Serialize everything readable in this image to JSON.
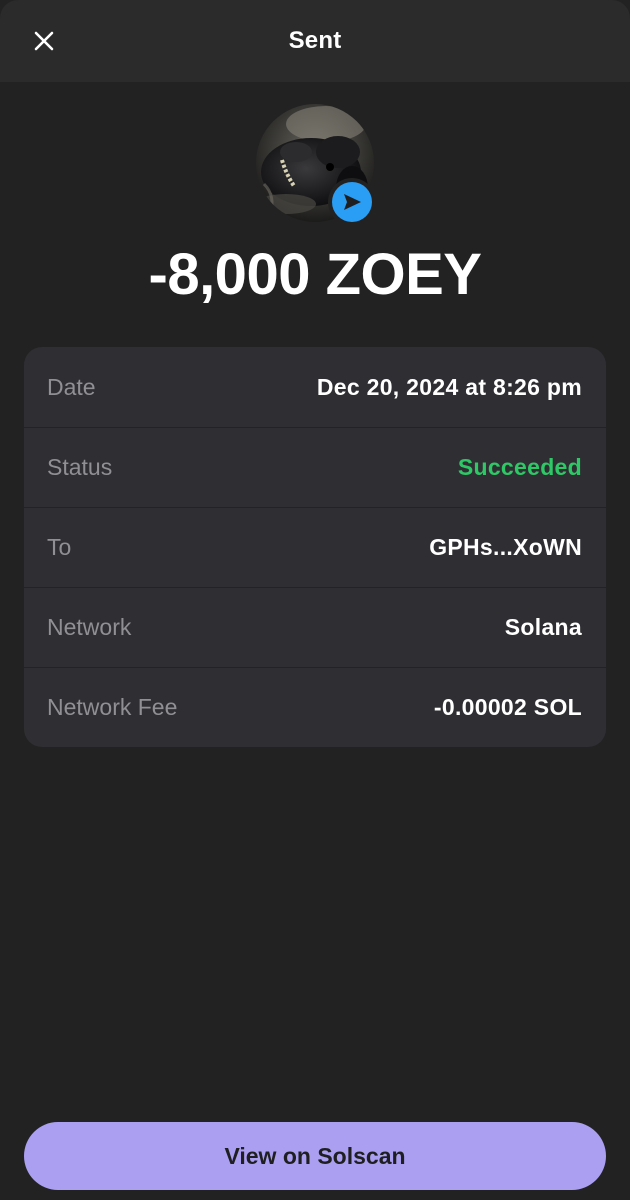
{
  "header": {
    "title": "Sent",
    "close_icon": "close-icon"
  },
  "transaction": {
    "amount": "-8,000 ZOEY",
    "token_image": "token-avatar-image",
    "badge_icon": "send-arrow-icon",
    "badge_color": "#2a9df4"
  },
  "details": [
    {
      "label": "Date",
      "value": "Dec 20, 2024 at 8:26 pm"
    },
    {
      "label": "Status",
      "value": "Succeeded"
    },
    {
      "label": "To",
      "value": "GPHs...XoWN"
    },
    {
      "label": "Network",
      "value": "Solana"
    },
    {
      "label": "Network Fee",
      "value": "-0.00002 SOL"
    }
  ],
  "colors": {
    "background": "#222222",
    "card": "#2f2f33",
    "accent": "#ab9ff2",
    "success": "#2ec866"
  },
  "footer": {
    "button_label": "View on Solscan"
  }
}
